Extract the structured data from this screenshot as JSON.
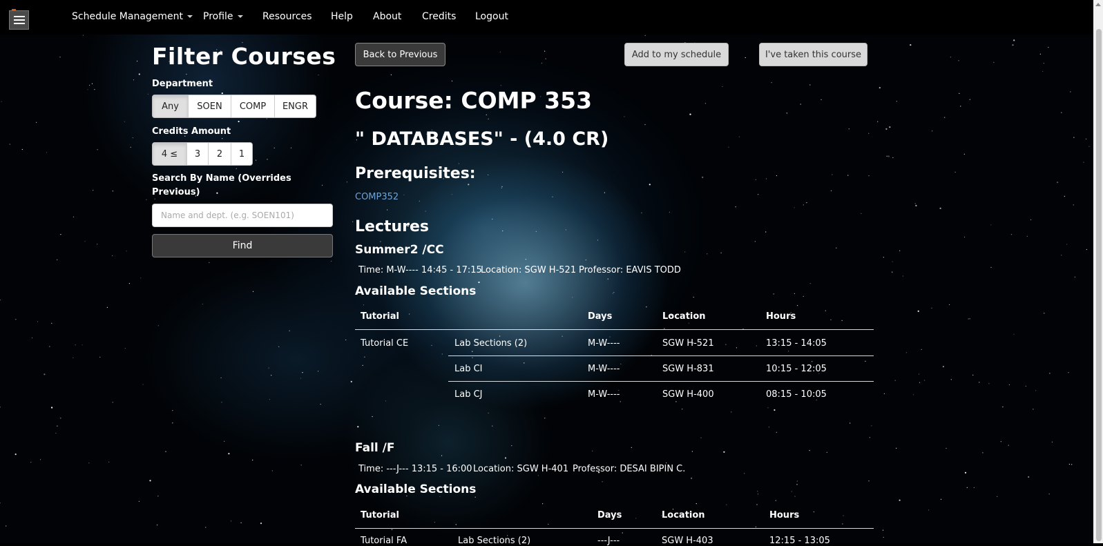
{
  "nav": {
    "items": [
      {
        "label": "Schedule Management",
        "dropdown": true
      },
      {
        "label": "Profile",
        "dropdown": true
      },
      {
        "label": "Resources"
      },
      {
        "label": "Help"
      },
      {
        "label": "About"
      },
      {
        "label": "Credits"
      },
      {
        "label": "Logout"
      }
    ]
  },
  "filter": {
    "title": "Filter Courses",
    "department_label": "Department",
    "departments": [
      "Any",
      "SOEN",
      "COMP",
      "ENGR"
    ],
    "department_selected": "Any",
    "credits_label": "Credits Amount",
    "credits": [
      "4 ≤",
      "3",
      "2",
      "1"
    ],
    "credits_selected": "4 ≤",
    "search_label_line1": "Search By Name (Overrides",
    "search_label_line2": "Previous)",
    "search_placeholder": "Name and dept. (e.g. SOEN101)",
    "find_label": "Find"
  },
  "actions": {
    "back": "Back to Previous",
    "add": "Add to my schedule",
    "taken": "I've taken this course"
  },
  "course": {
    "heading": "Course: COMP 353",
    "title": "\" DATABASES\" - (4.0 CR)",
    "prereq_heading": "Prerequisites:",
    "prereq_link": "COMP352",
    "lectures_heading": "Lectures"
  },
  "lectures": [
    {
      "term": "Summer2 /CC",
      "time": "Time: M-W---- 14:45 - 17:15",
      "location": "Location: SGW H-521",
      "professor": "Professor: EAVIS TODD",
      "sections_heading": "Available Sections",
      "headers": {
        "tutorial": "Tutorial",
        "days": "Days",
        "location": "Location",
        "hours": "Hours"
      },
      "rows": [
        {
          "tutorial": "Tutorial CE",
          "lab": "Lab Sections (2)",
          "days": "M-W----",
          "location": "SGW H-521",
          "hours": "13:15 - 14:05"
        },
        {
          "tutorial": "",
          "lab": "Lab CI",
          "days": "M-W----",
          "location": "SGW H-831",
          "hours": "10:15 - 12:05"
        },
        {
          "tutorial": "",
          "lab": "Lab CJ",
          "days": "M-W----",
          "location": "SGW H-400",
          "hours": "08:15 - 10:05"
        }
      ]
    },
    {
      "term": "Fall /F",
      "time": "Time: ---J--- 13:15 - 16:00",
      "location": "Location: SGW H-401",
      "professor": "Professor: DESAI BIPIN C.",
      "sections_heading": "Available Sections",
      "headers": {
        "tutorial": "Tutorial",
        "days": "Days",
        "location": "Location",
        "hours": "Hours"
      },
      "rows": [
        {
          "tutorial": "Tutorial FA",
          "lab": "Lab Sections (2)",
          "days": "---J---",
          "location": "SGW H-403",
          "hours": "12:15 - 13:05"
        }
      ]
    }
  ]
}
